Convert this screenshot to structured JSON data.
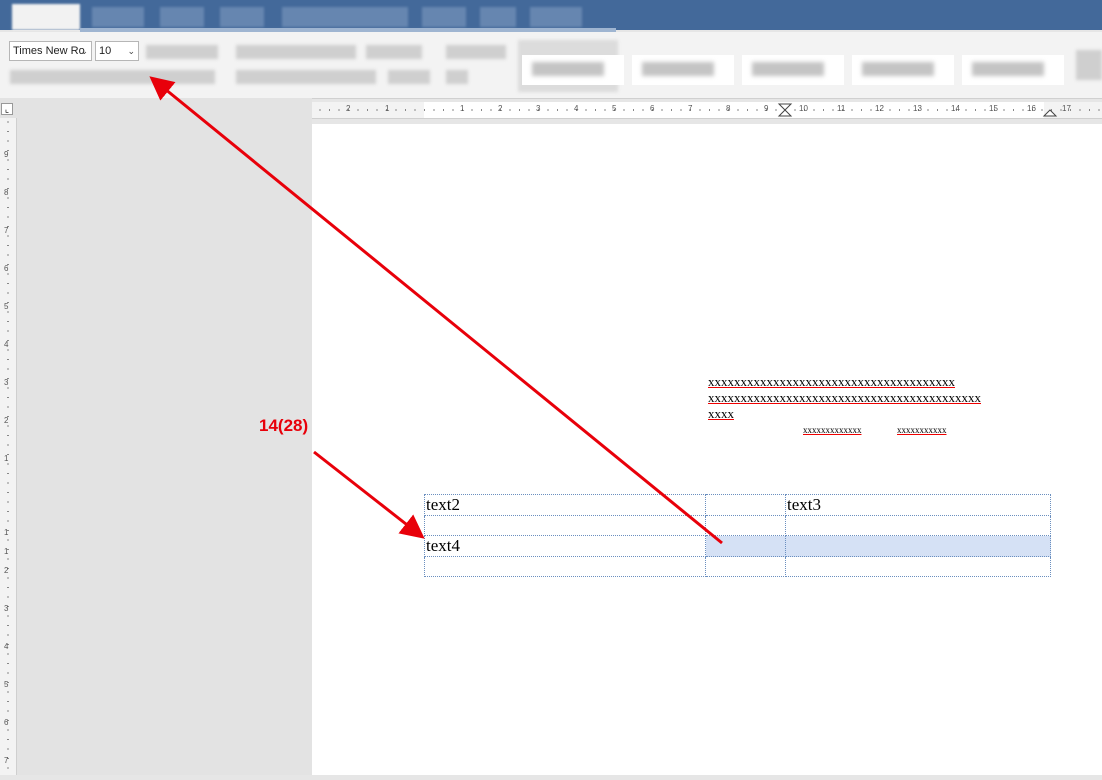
{
  "toolbar": {
    "font_name": "Times New Ro",
    "font_size": "10"
  },
  "document": {
    "line1": "xxxxxxxxxxxxxxxxxxxxxxxxxxxxxxxxxxxxxx",
    "line2": "xxxxxxxxxxxxxxxxxxxxxxxxxxxxxxxxxxxxxxxxxx",
    "line3": "xxxx",
    "small_left": "xxxxxxxxxxxxx",
    "small_right": "xxxxxxxxxxx",
    "table": {
      "rows": [
        [
          "text2",
          "",
          "text3"
        ],
        [
          "",
          "",
          ""
        ],
        [
          "text4",
          "",
          ""
        ],
        [
          "",
          "",
          ""
        ]
      ]
    }
  },
  "ruler": {
    "top_ticks": [
      "2",
      "1",
      "1",
      "2",
      "3",
      "4",
      "5",
      "6",
      "7",
      "8",
      "9",
      "10",
      "11",
      "12",
      "13",
      "14",
      "15",
      "16",
      "17"
    ],
    "left_ticks": [
      "9",
      "8",
      "7",
      "6",
      "5",
      "4",
      "3",
      "2",
      "1",
      "1",
      "1",
      "2",
      "3",
      "4",
      "5",
      "6",
      "7"
    ]
  },
  "annotation": {
    "label": "14(28)"
  },
  "colors": {
    "arrow": "#e8000a",
    "titlebar": "#43699a",
    "selection": "#d5e1f5"
  }
}
